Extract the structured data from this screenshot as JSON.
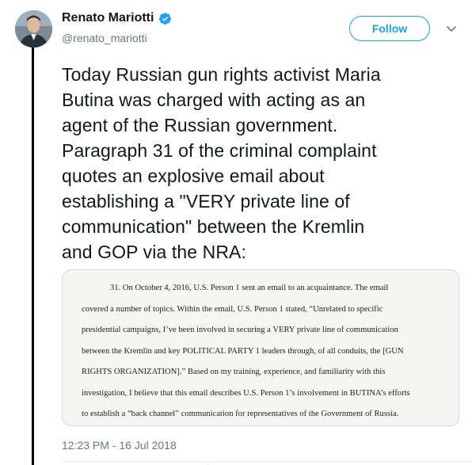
{
  "author": {
    "display_name": "Renato Mariotti",
    "handle": "@renato_mariotti",
    "verified": true
  },
  "follow_label": "Follow",
  "tweet": {
    "lines": [
      "Today Russian gun rights activist Maria",
      "Butina was charged with acting as an",
      "agent of the Russian government.",
      "Paragraph 31 of the criminal complaint",
      "quotes an explosive email about",
      "establishing a \"VERY private line of",
      "communication\" between the Kremlin",
      "and GOP via the NRA:"
    ]
  },
  "document_image": {
    "lines": [
      "31.    On October 4, 2016, U.S. Person 1 sent an email to an acquaintance.  The email",
      "covered a number of topics.  Within the email, U.S. Person 1 stated, “Unrelated to specific",
      "presidential campaigns, I’ve been involved in securing a VERY private line of communication",
      "between the Kremlin and key POLITICAL PARTY 1 leaders through, of all conduits, the [GUN",
      "RIGHTS ORGANIZATION].”   Based on my training, experience, and familiarity with this",
      "investigation, I believe that this email describes U.S. Person 1’s involvement in BUTINA’s efforts",
      "to establish a “back channel” communication for representatives of the Government of Russia."
    ]
  },
  "timestamp": "12:23 PM - 16 Jul 2018",
  "colors": {
    "accent": "#1da1f2",
    "text": "#14171a",
    "muted": "#657786"
  },
  "icons": {
    "verified": "verified-badge-icon",
    "menu": "chevron-down-icon"
  }
}
